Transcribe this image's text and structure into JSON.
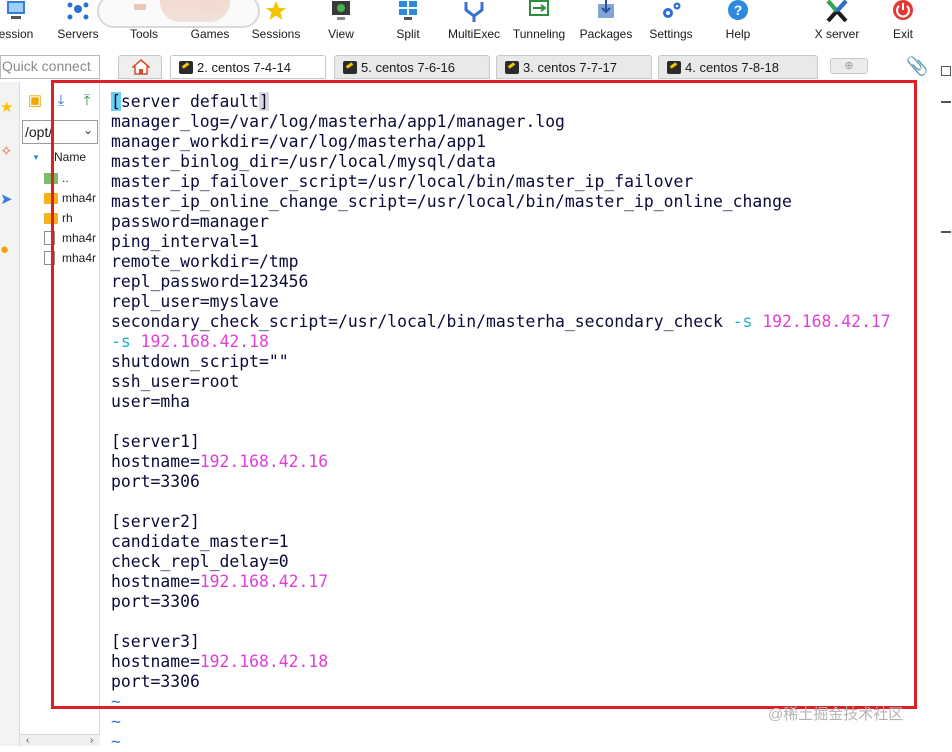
{
  "toolbar": {
    "items": [
      {
        "label": "ession",
        "icon": "session-icon"
      },
      {
        "label": "Servers",
        "icon": "servers-icon"
      },
      {
        "label": "Tools",
        "icon": "tools-icon"
      },
      {
        "label": "Games",
        "icon": "games-icon"
      },
      {
        "label": "Sessions",
        "icon": "star-icon"
      },
      {
        "label": "View",
        "icon": "view-icon"
      },
      {
        "label": "Split",
        "icon": "split-icon"
      },
      {
        "label": "MultiExec",
        "icon": "multiexec-icon"
      },
      {
        "label": "Tunneling",
        "icon": "tunneling-icon"
      },
      {
        "label": "Packages",
        "icon": "packages-icon"
      },
      {
        "label": "Settings",
        "icon": "gear-icon"
      },
      {
        "label": "Help",
        "icon": "help-icon"
      },
      {
        "label": "X server",
        "icon": "x-server-icon"
      },
      {
        "label": "Exit",
        "icon": "power-icon"
      }
    ]
  },
  "quick_connect": {
    "placeholder": "Quick connect"
  },
  "tabs": [
    {
      "label": "2. centos 7-4-14",
      "active": true
    },
    {
      "label": "5. centos 7-6-16",
      "active": false
    },
    {
      "label": "3. centos 7-7-17",
      "active": false
    },
    {
      "label": "4. centos 7-8-18",
      "active": false
    }
  ],
  "file_browser": {
    "path": "/opt/",
    "column_header": "Name",
    "entries": [
      {
        "name": "..",
        "type": "up"
      },
      {
        "name": "mha4r",
        "type": "folder"
      },
      {
        "name": "rh",
        "type": "folder"
      },
      {
        "name": "mha4r",
        "type": "file"
      },
      {
        "name": "mha4r",
        "type": "file"
      }
    ]
  },
  "terminal": {
    "lines": [
      "[server default]",
      "manager_log=/var/log/masterha/app1/manager.log",
      "manager_workdir=/var/log/masterha/app1",
      "master_binlog_dir=/usr/local/mysql/data",
      "master_ip_failover_script=/usr/local/bin/master_ip_failover",
      "master_ip_online_change_script=/usr/local/bin/master_ip_online_change",
      "password=manager",
      "ping_interval=1",
      "remote_workdir=/tmp",
      "repl_password=123456",
      "repl_user=myslave",
      "secondary_check_script=/usr/local/bin/masterha_secondary_check -s 192.168.42.17",
      "-s 192.168.42.18",
      "shutdown_script=\"\"",
      "ssh_user=root",
      "user=mha",
      "",
      "[server1]",
      "hostname=192.168.42.16",
      "port=3306",
      "",
      "[server2]",
      "candidate_master=1",
      "check_repl_delay=0",
      "hostname=192.168.42.17",
      "port=3306",
      "",
      "[server3]",
      "hostname=192.168.42.18",
      "port=3306",
      "~",
      "~",
      "~"
    ],
    "colors": {
      "text": "#0b0b3a",
      "ip": "#e040d6",
      "flag": "#20b0c8",
      "tilde": "#3a6ee0",
      "cursor": "#6ad1f6"
    }
  },
  "highlight": {
    "color": "#dd1f26"
  },
  "watermark": "@稀土掘金技术社区"
}
